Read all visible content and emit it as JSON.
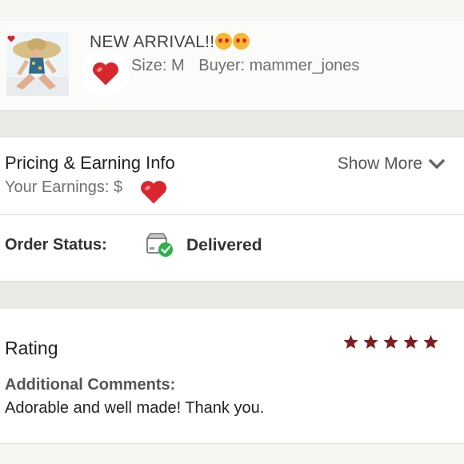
{
  "item": {
    "title": "NEW ARRIVAL!!",
    "size": "Size: M",
    "buyer": "Buyer: mammer_jones",
    "thumbnail_icon": "swimsuit-photo",
    "title_emojis": [
      "heart-eyes-emoji",
      "heart-eyes-emoji"
    ]
  },
  "pricing": {
    "title": "Pricing & Earning Info",
    "earnings_label": "Your Earnings: $",
    "show_more_label": "Show More",
    "show_more_icon": "chevron-down-icon"
  },
  "order": {
    "status_label": "Order Status:",
    "status_value": "Delivered",
    "status_icon": "box-check-icon"
  },
  "rating": {
    "title": "Rating",
    "stars": 5,
    "comments_label": "Additional Comments:",
    "comments_text": "Adorable and well made! Thank you."
  },
  "colors": {
    "heart": "#d8262c",
    "star": "#7e1d22",
    "check": "#2fb24c",
    "band": "#ebe9e4"
  }
}
